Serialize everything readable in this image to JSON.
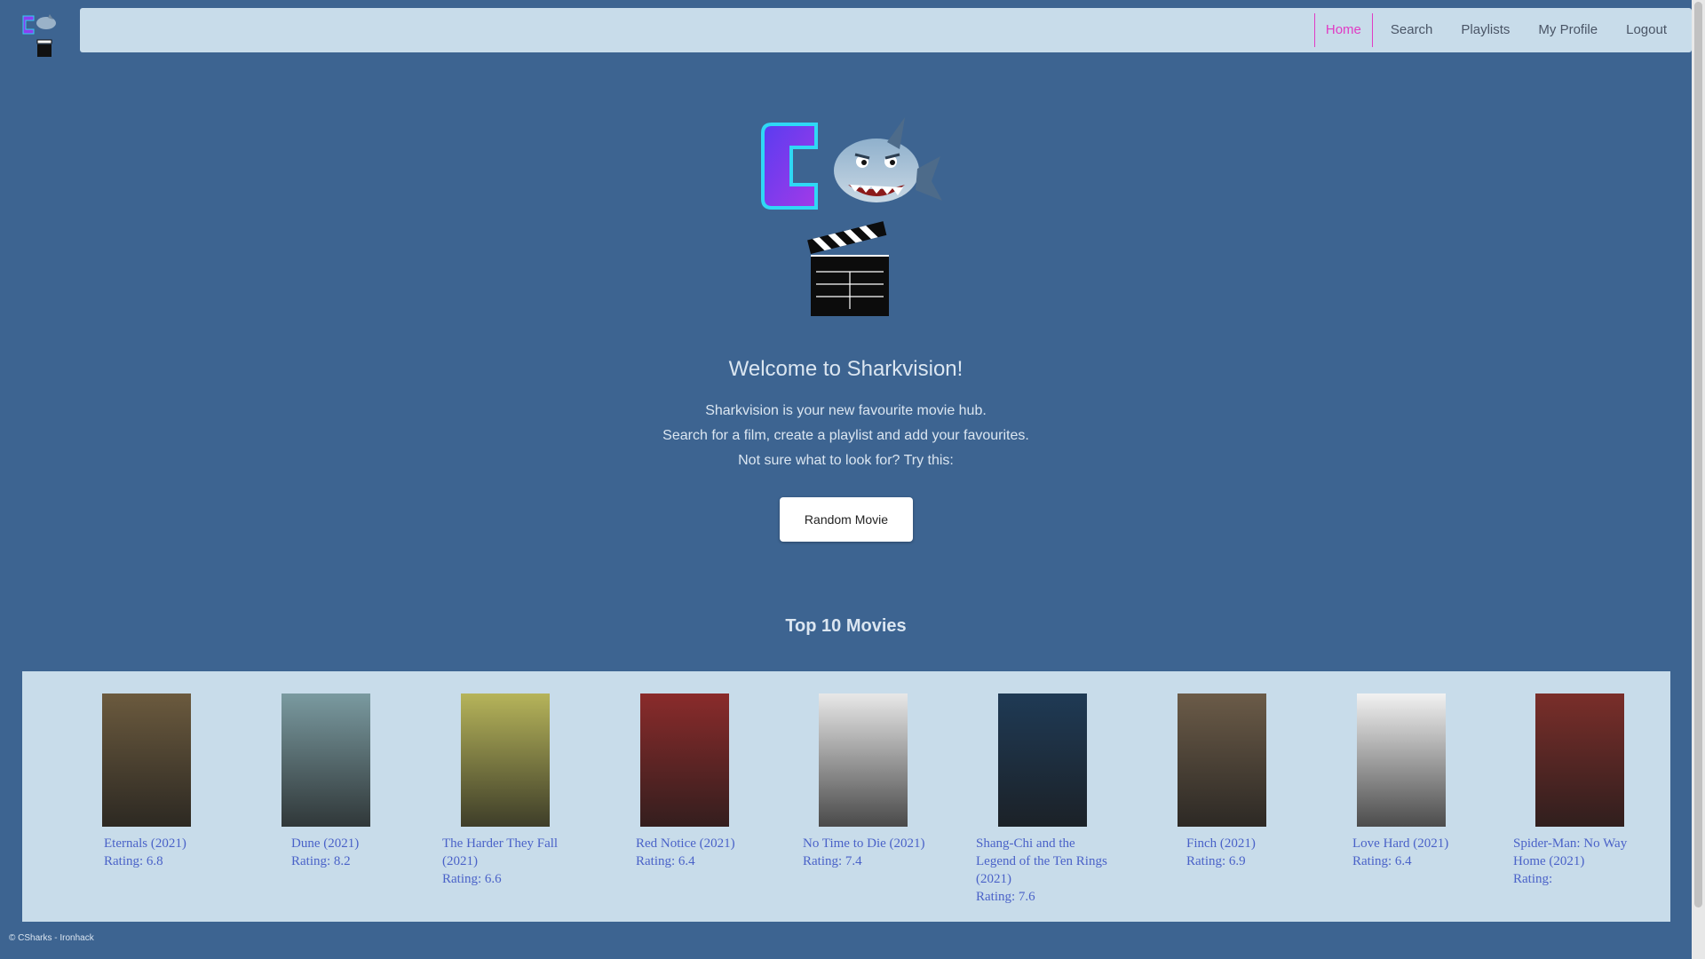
{
  "nav": {
    "links": [
      {
        "label": "Home",
        "active": true
      },
      {
        "label": "Search",
        "active": false
      },
      {
        "label": "Playlists",
        "active": false
      },
      {
        "label": "My Profile",
        "active": false
      },
      {
        "label": "Logout",
        "active": false
      }
    ]
  },
  "hero": {
    "title": "Welcome to Sharkvision!",
    "lines": [
      "Sharkvision is your new favourite movie hub.",
      "Search for a film, create a playlist and add your favourites.",
      "Not sure what to look for? Try this:"
    ],
    "random_button": "Random Movie"
  },
  "top10": {
    "title": "Top 10 Movies",
    "movies": [
      {
        "title": "Eternals (2021)",
        "rating": "Rating: 6.8",
        "poster_color": "#6b5a3e"
      },
      {
        "title": "Dune (2021)",
        "rating": "Rating: 8.2",
        "poster_color": "#7a9aa0"
      },
      {
        "title": "The Harder They Fall (2021)",
        "rating": "Rating: 6.6",
        "poster_color": "#b6b45a"
      },
      {
        "title": "Red Notice (2021)",
        "rating": "Rating: 6.4",
        "poster_color": "#8a2b2b"
      },
      {
        "title": "No Time to Die (2021)",
        "rating": "Rating: 7.4",
        "poster_color": "#e8e8e8"
      },
      {
        "title": "Shang-Chi and the Legend of the Ten Rings (2021)",
        "rating": "Rating: 7.6",
        "poster_color": "#1f3a55"
      },
      {
        "title": "Finch (2021)",
        "rating": "Rating: 6.9",
        "poster_color": "#6b5b48"
      },
      {
        "title": "Love Hard (2021)",
        "rating": "Rating: 6.4",
        "poster_color": "#f2f2f2"
      },
      {
        "title": "Spider-Man: No Way Home (2021)",
        "rating": "Rating:",
        "poster_color": "#7a2e2a"
      }
    ]
  },
  "footer": "© CSharks - Ironhack",
  "colors": {
    "page_bg": "#3d6491",
    "panel_bg": "#c8dcea",
    "accent": "#e13bc4",
    "link": "#4a62c8"
  }
}
